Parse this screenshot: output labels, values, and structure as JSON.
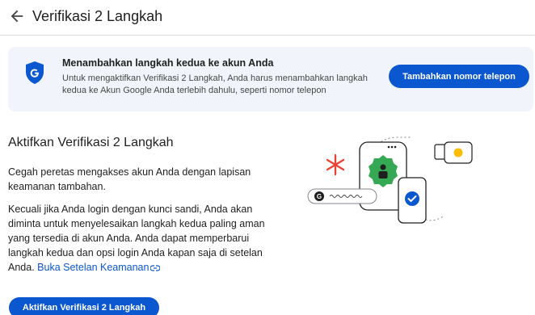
{
  "header": {
    "back_icon": "arrow-back-icon",
    "title": "Verifikasi 2 Langkah"
  },
  "banner": {
    "icon": "google-shield-icon",
    "title": "Menambahkan langkah kedua ke akun Anda",
    "description": "Untuk mengaktifkan Verifikasi 2 Langkah, Anda harus menambahkan langkah kedua ke Akun Google Anda terlebih dahulu, seperti nomor telepon",
    "button_label": "Tambahkan nomor telepon",
    "background": "#f1f5fb",
    "accent": "#0b57d0"
  },
  "main": {
    "title": "Aktifkan Verifikasi 2 Langkah",
    "paragraph1": "Cegah peretas mengakses akun Anda dengan lapisan keamanan tambahan.",
    "paragraph2": "Kecuali jika Anda login dengan kunci sandi, Anda akan diminta untuk menyelesaikan langkah kedua paling aman yang tersedia di akun Anda. Anda dapat memperbarui langkah kedua dan opsi login Anda kapan saja di setelan Anda.",
    "link_label": "Buka Setelan Keamanan",
    "link_icon": "link-icon",
    "button_label": "Aktifkan Verifikasi 2 Langkah"
  },
  "illustration": {
    "icons": [
      "asterisk-icon",
      "phone-icon",
      "person-icon",
      "security-key-icon",
      "check-icon",
      "google-g-icon"
    ],
    "colors": {
      "red": "#ea4335",
      "green": "#34a853",
      "yellow": "#fbbc04",
      "blue": "#0b57d0"
    }
  }
}
